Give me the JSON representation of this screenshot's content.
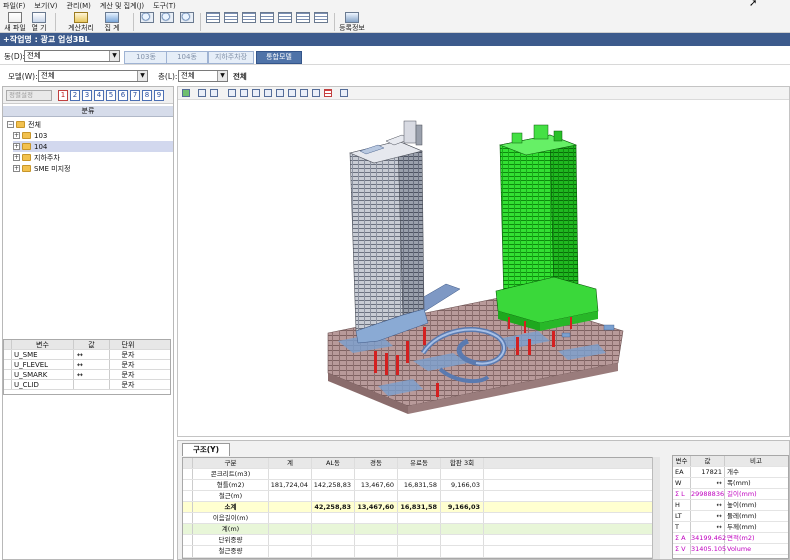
{
  "menu": [
    "파일(F)",
    "보기(V)",
    "관리(M)",
    "계산 및 집계(J)",
    "도구(T)"
  ],
  "toolbar": {
    "new_file": "새 파일",
    "open": "열 기",
    "calc": "계산처리",
    "sum": "집 계",
    "register_info": "등록정보"
  },
  "title_bar": "+작업명 : 광교 업성3BL",
  "dong": {
    "label": "동(D):",
    "value": "전체",
    "tabs": [
      {
        "label": "103동",
        "active": false
      },
      {
        "label": "104동",
        "active": false
      },
      {
        "label": "지하주차장",
        "active": false
      },
      {
        "label": "통합모델",
        "active": true
      }
    ]
  },
  "model": {
    "label": "모델(W):",
    "value": "전체",
    "floor_label": "층(L):",
    "floor_value": "전체",
    "floor_text": "전체"
  },
  "left_toolbar": {
    "sort_label": "정렬설정",
    "numbers": [
      "1",
      "2",
      "3",
      "4",
      "5",
      "6",
      "7",
      "8",
      "9"
    ]
  },
  "tree": {
    "header": "분류",
    "items": [
      {
        "label": "전체",
        "level": 0,
        "selected": false
      },
      {
        "label": "103",
        "level": 1,
        "selected": false
      },
      {
        "label": "104",
        "level": 1,
        "selected": true
      },
      {
        "label": "지하주차",
        "level": 1,
        "selected": false
      },
      {
        "label": "SME 미지정",
        "level": 1,
        "selected": false
      }
    ]
  },
  "var_table": {
    "headers": [
      "변수",
      "값",
      "단위"
    ],
    "rows": [
      {
        "name": "U_SME",
        "value": "↔",
        "unit": "문자"
      },
      {
        "name": "U_FLEVEL",
        "value": "↔",
        "unit": "문자"
      },
      {
        "name": "U_SMARK",
        "value": "↔",
        "unit": "문자"
      },
      {
        "name": "U_CLID",
        "value": "",
        "unit": "문자"
      }
    ]
  },
  "bottom_tab": "구조(Y)",
  "qty_table": {
    "headers": [
      "구분",
      "계",
      "AL동",
      "경동",
      "유료동",
      "합판 3회"
    ],
    "rows": [
      {
        "label": "콘크리트(m3)",
        "cells": [
          "",
          "",
          "",
          "",
          ""
        ],
        "style": "normal"
      },
      {
        "label": "형틀(m2)",
        "cells": [
          "181,724,04",
          "142,258,83",
          "13,467,60",
          "16,831,58",
          "9,166,03"
        ],
        "style": "normal"
      },
      {
        "label": "철근(m)",
        "cells": [
          "",
          "",
          "",
          "",
          ""
        ],
        "style": "normal"
      },
      {
        "label": "소계",
        "cells": [
          "",
          "42,258,83",
          "13,467,60",
          "16,831,58",
          "9,166,03"
        ],
        "style": "yellow"
      },
      {
        "label": "이음길이(m)",
        "cells": [
          "",
          "",
          "",
          "",
          ""
        ],
        "style": "normal"
      },
      {
        "label": "계(m)",
        "cells": [
          "",
          "",
          "",
          "",
          ""
        ],
        "style": "green"
      },
      {
        "label": "단위중량",
        "cells": [
          "",
          "",
          "",
          "",
          ""
        ],
        "style": "normal"
      },
      {
        "label": "철근중량",
        "cells": [
          "",
          "",
          "",
          "",
          ""
        ],
        "style": "normal"
      }
    ]
  },
  "prop_table": {
    "headers": [
      "변수",
      "값",
      "비고"
    ],
    "rows": [
      {
        "name": "EA",
        "value": "17821",
        "note": "개수",
        "sigma": false
      },
      {
        "name": "W",
        "value": "↔",
        "note": "폭(mm)",
        "sigma": false
      },
      {
        "name": "Σ L",
        "value": "29988836",
        "note": "길이(mm)",
        "sigma": true
      },
      {
        "name": "H",
        "value": "↔",
        "note": "높이(mm)",
        "sigma": false
      },
      {
        "name": "LT",
        "value": "↔",
        "note": "둘레(mm)",
        "sigma": false
      },
      {
        "name": "T",
        "value": "↔",
        "note": "두께(mm)",
        "sigma": false
      },
      {
        "name": "Σ A",
        "value": "34199.462",
        "note": "면적(m2)",
        "sigma": true
      },
      {
        "name": "Σ V",
        "value": "31405.105",
        "note": "Volume",
        "sigma": true
      }
    ]
  },
  "colors": {
    "title_bar": "#3c5a8c",
    "tower_green": "#22d022",
    "tower_grey": "#b8bcc4",
    "podium_floor": "#b09090",
    "accent_blue": "#4f73a8"
  }
}
